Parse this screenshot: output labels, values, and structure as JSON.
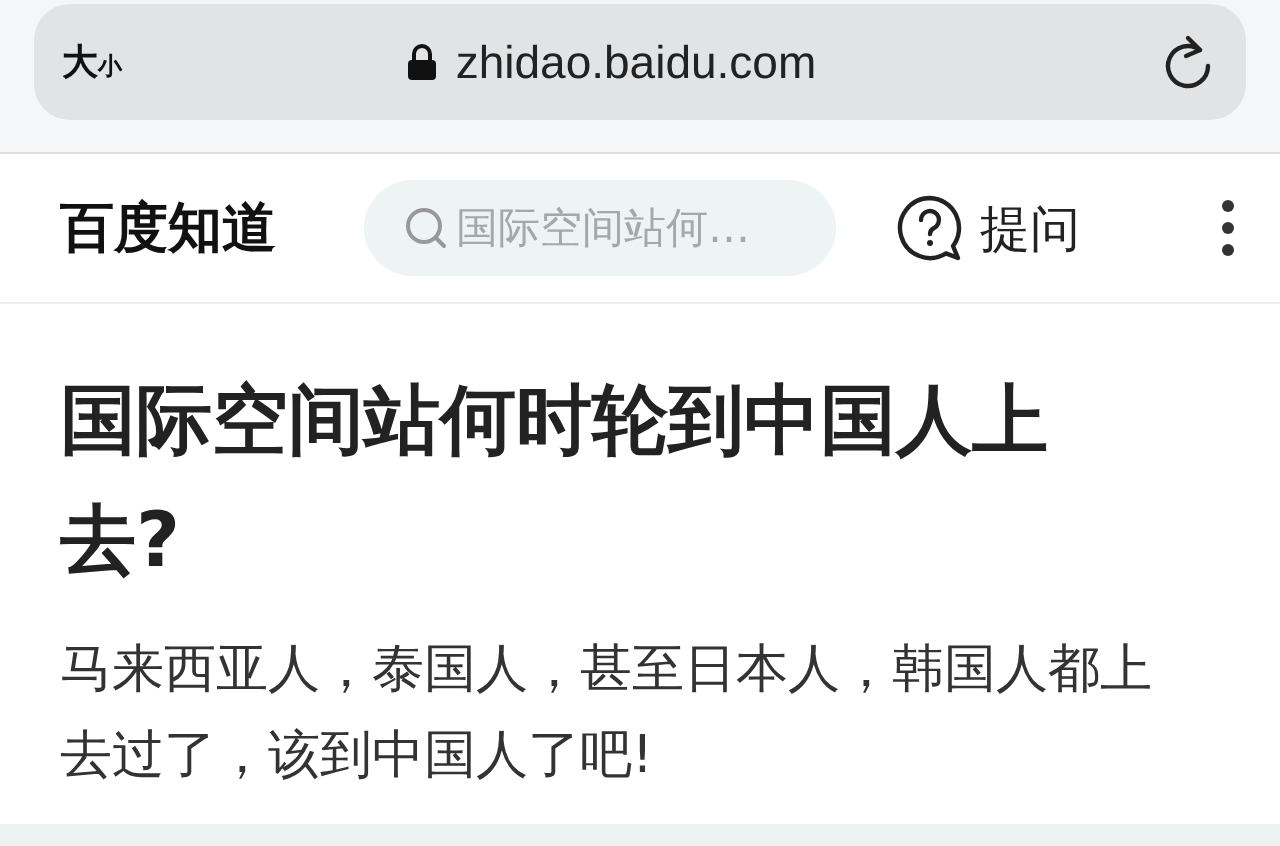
{
  "address_bar": {
    "text_size_button": {
      "large": "大",
      "small": "小"
    },
    "url": "zhidao.baidu.com"
  },
  "header": {
    "logo": "百度知道",
    "search": {
      "placeholder": "国际空间站何…"
    },
    "ask_button": "提问"
  },
  "question": {
    "title": "国际空间站何时轮到中国人上去?",
    "body": "马来西亚人，泰国人，甚至日本人，韩国人都上去过了，该到中国人了吧!"
  }
}
